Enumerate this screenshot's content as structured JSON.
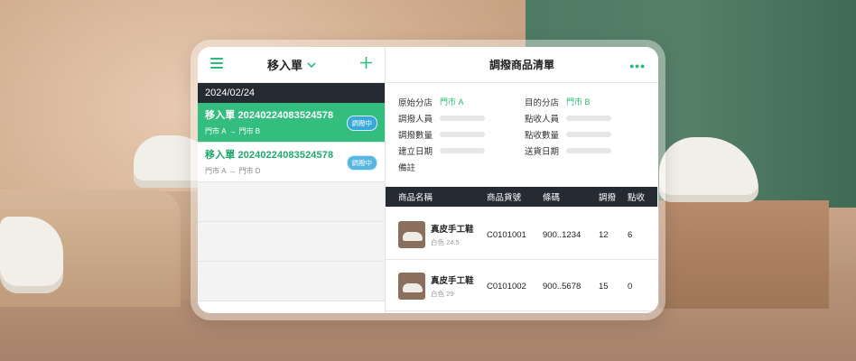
{
  "left_panel": {
    "title": "移入單",
    "date": "2024/02/24",
    "orders": [
      {
        "no": "移入單 20240224083524578",
        "from": "門市 A",
        "to": "門市 B",
        "status": "調撥中",
        "active": true
      },
      {
        "no": "移入單 20240224083524578",
        "from": "門市 A",
        "to": "門市 D",
        "status": "調撥中",
        "active": false
      }
    ]
  },
  "right_panel": {
    "title": "調撥商品清單",
    "info": {
      "origin_label": "原始分店",
      "origin_value": "門市 A",
      "dest_label": "目的分店",
      "dest_value": "門市 B",
      "transfer_person_label": "調撥人員",
      "receive_person_label": "點收人員",
      "transfer_qty_label": "調撥數量",
      "receive_qty_label": "點收數量",
      "created_date_label": "建立日期",
      "ship_date_label": "送貨日期",
      "note_label": "備註"
    },
    "table": {
      "headers": [
        "商品名稱",
        "商品貨號",
        "條碼",
        "調撥",
        "點收"
      ],
      "rows": [
        {
          "name": "真皮手工鞋",
          "variant": "白色 24.5",
          "sku": "C0101001",
          "barcode": "900..1234",
          "transfer": "12",
          "received": "6"
        },
        {
          "name": "真皮手工鞋",
          "variant": "白色 29",
          "sku": "C0101002",
          "barcode": "900..5678",
          "transfer": "15",
          "received": "0"
        }
      ]
    }
  },
  "colors": {
    "accent": "#2dbb7a",
    "dark_bar": "#262a33",
    "badge": "#3aa7d9"
  },
  "icons": [
    "menu-icon",
    "chevron-down-icon",
    "plus-icon",
    "more-dots-icon",
    "arrow-right-icon"
  ]
}
